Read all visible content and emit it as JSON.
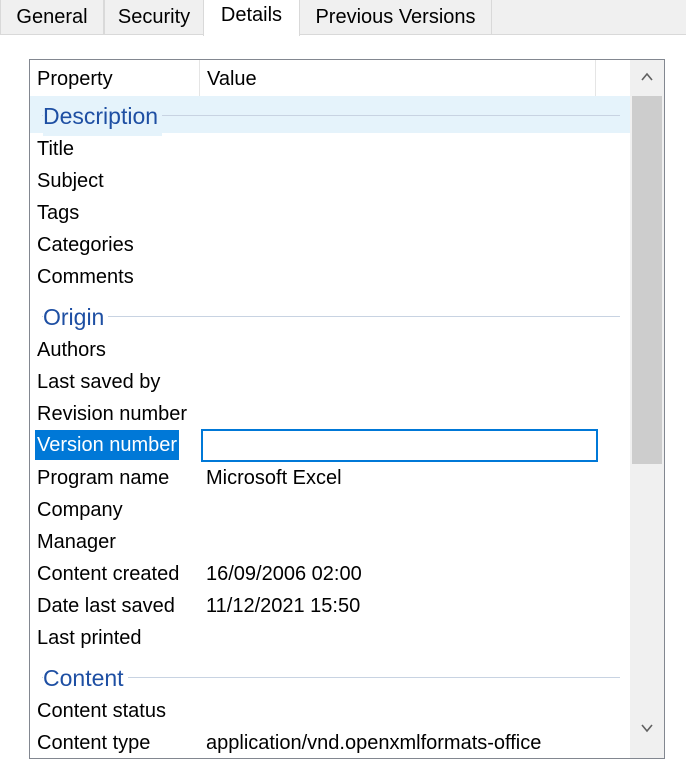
{
  "tabs": [
    "General",
    "Security",
    "Details",
    "Previous Versions"
  ],
  "active_tab": "Details",
  "columns": {
    "property": "Property",
    "value": "Value"
  },
  "groups": {
    "description": {
      "title": "Description",
      "rows": [
        {
          "name": "Title",
          "value": ""
        },
        {
          "name": "Subject",
          "value": ""
        },
        {
          "name": "Tags",
          "value": ""
        },
        {
          "name": "Categories",
          "value": ""
        },
        {
          "name": "Comments",
          "value": ""
        }
      ]
    },
    "origin": {
      "title": "Origin",
      "rows": [
        {
          "name": "Authors",
          "value": ""
        },
        {
          "name": "Last saved by",
          "value": ""
        },
        {
          "name": "Revision number",
          "value": ""
        },
        {
          "name": "Version number",
          "value": ""
        },
        {
          "name": "Program name",
          "value": "Microsoft Excel"
        },
        {
          "name": "Company",
          "value": ""
        },
        {
          "name": "Manager",
          "value": ""
        },
        {
          "name": "Content created",
          "value": "16/09/2006 02:00"
        },
        {
          "name": "Date last saved",
          "value": "11/12/2021 15:50"
        },
        {
          "name": "Last printed",
          "value": ""
        }
      ]
    },
    "content": {
      "title": "Content",
      "rows": [
        {
          "name": "Content status",
          "value": ""
        },
        {
          "name": "Content type",
          "value": "application/vnd.openxmlformats-office"
        }
      ]
    }
  },
  "selected_row": "Version number",
  "icons": {
    "scroll_up": "chevron-up-icon",
    "scroll_down": "chevron-down-icon"
  },
  "colors": {
    "selection": "#0078d7",
    "group_title": "#1e4fa3",
    "group_highlight": "#e5f3fb"
  }
}
